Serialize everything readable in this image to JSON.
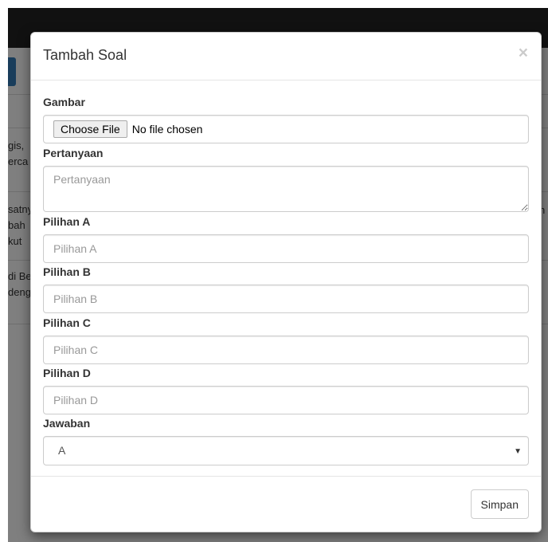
{
  "background": {
    "fragments": [
      "gis,",
      "erca",
      "satny",
      "bah",
      "kut",
      "di Be",
      "deng"
    ],
    "right_fragment": "n"
  },
  "modal": {
    "title": "Tambah Soal",
    "close_symbol": "×",
    "fields": {
      "gambar": {
        "label": "Gambar",
        "button": "Choose File",
        "status": "No file chosen"
      },
      "pertanyaan": {
        "label": "Pertanyaan",
        "placeholder": "Pertanyaan",
        "value": ""
      },
      "pilihan_a": {
        "label": "Pilihan A",
        "placeholder": "Pilihan A",
        "value": ""
      },
      "pilihan_b": {
        "label": "Pilihan B",
        "placeholder": "Pilihan B",
        "value": ""
      },
      "pilihan_c": {
        "label": "Pilihan C",
        "placeholder": "Pilihan C",
        "value": ""
      },
      "pilihan_d": {
        "label": "Pilihan D",
        "placeholder": "Pilihan D",
        "value": ""
      },
      "jawaban": {
        "label": "Jawaban",
        "selected": "A"
      }
    },
    "submit_label": "Simpan"
  },
  "colors": {
    "overlay": "#000000",
    "primary": "#337ab7",
    "topbar": "#222222"
  },
  "icons": {
    "close": "close-icon",
    "select_arrow": "chevron-down-icon"
  }
}
